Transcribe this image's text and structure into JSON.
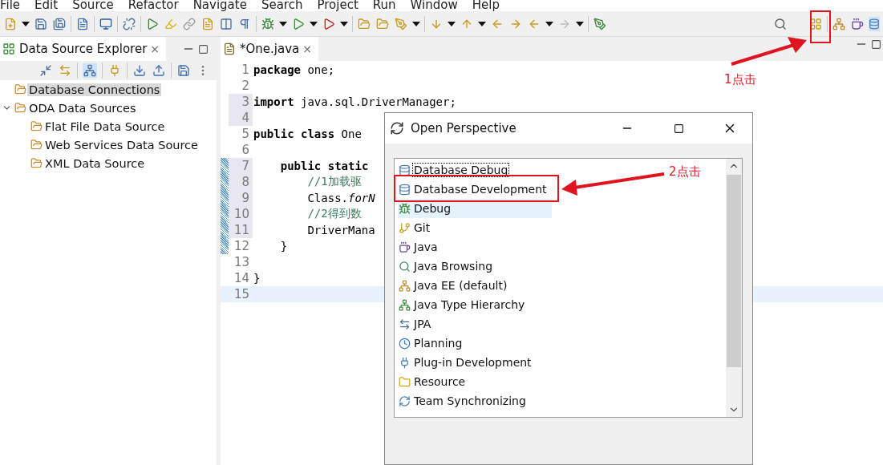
{
  "menu": [
    "File",
    "Edit",
    "Source",
    "Refactor",
    "Navigate",
    "Search",
    "Project",
    "Run",
    "Window",
    "Help"
  ],
  "explorer": {
    "title": "Data Source Explorer",
    "close": "×",
    "tree": [
      {
        "label": "Database Connections",
        "selected": true
      },
      {
        "label": "ODA Data Sources",
        "selected": false,
        "expanded": true,
        "children": [
          {
            "label": "Flat File Data Source",
            "selected": false
          },
          {
            "label": "Web Services Data Source",
            "selected": false
          },
          {
            "label": "XML Data Source",
            "selected": false
          }
        ]
      }
    ]
  },
  "editor": {
    "tab": "*One.java",
    "close": "×",
    "lines": [
      {
        "number": "1",
        "text": "**package** one;",
        "kind": "code",
        "shaded": false,
        "changed": false,
        "current": false
      },
      {
        "number": "2",
        "shaded": false,
        "changed": false,
        "current": false
      },
      {
        "number": "3",
        "text": "**import** java.sql.DriverManager;",
        "kind": "code",
        "shaded": true,
        "changed": false,
        "current": false
      },
      {
        "number": "4",
        "shaded": true,
        "changed": false,
        "current": false
      },
      {
        "number": "5",
        "text": "**public** **class** One",
        "kind": "code",
        "shaded": false,
        "changed": false,
        "current": false
      },
      {
        "number": "6",
        "shaded": false,
        "changed": false,
        "current": false
      },
      {
        "number": "7",
        "text": "    **public** **static**",
        "kind": "code",
        "shaded": true,
        "changed": true,
        "current": false
      },
      {
        "number": "8",
        "text": "        //1加载驱",
        "kind": "comment",
        "shaded": true,
        "changed": true,
        "current": false
      },
      {
        "number": "9",
        "text": "        Class.*forN*",
        "kind": "code",
        "shaded": true,
        "changed": true,
        "current": false
      },
      {
        "number": "10",
        "text": "        //2得到数",
        "kind": "comment",
        "shaded": true,
        "changed": true,
        "current": false
      },
      {
        "number": "11",
        "text": "        DriverMana",
        "kind": "code",
        "shaded": true,
        "changed": true,
        "current": false
      },
      {
        "number": "12",
        "text": "    }",
        "kind": "code",
        "shaded": false,
        "changed": true,
        "current": false
      },
      {
        "number": "13",
        "shaded": false,
        "changed": false,
        "current": false
      },
      {
        "number": "14",
        "text": "}",
        "kind": "code",
        "shaded": false,
        "changed": false,
        "current": false
      },
      {
        "number": "15",
        "shaded": false,
        "changed": false,
        "current": true
      }
    ]
  },
  "dialog": {
    "title": "Open Perspective",
    "items": [
      {
        "label": "Database Debug",
        "kind": "database",
        "focused": true,
        "highlighted": false
      },
      {
        "label": "Database Development",
        "kind": "database",
        "focused": false,
        "highlighted": false
      },
      {
        "label": "Debug",
        "kind": "bug",
        "focused": false,
        "highlighted": true
      },
      {
        "label": "Git",
        "kind": "git",
        "focused": false,
        "highlighted": false
      },
      {
        "label": "Java",
        "kind": "java",
        "focused": false,
        "highlighted": false
      },
      {
        "label": "Java Browsing",
        "kind": "browse",
        "focused": false,
        "highlighted": false
      },
      {
        "label": "Java EE (default)",
        "kind": "tree",
        "focused": false,
        "highlighted": false
      },
      {
        "label": "Java Type Hierarchy",
        "kind": "hierarchy",
        "focused": false,
        "highlighted": false
      },
      {
        "label": "JPA",
        "kind": "arrows",
        "focused": false,
        "highlighted": false
      },
      {
        "label": "Planning",
        "kind": "clock",
        "focused": false,
        "highlighted": false
      },
      {
        "label": "Plug-in Development",
        "kind": "plug",
        "focused": false,
        "highlighted": false
      },
      {
        "label": "Resource",
        "kind": "folder",
        "focused": false,
        "highlighted": false
      },
      {
        "label": "Team Synchronizing",
        "kind": "sync",
        "focused": false,
        "highlighted": false
      }
    ]
  },
  "annotations": [
    {
      "text": "1点击"
    },
    {
      "text": "2点击"
    }
  ]
}
